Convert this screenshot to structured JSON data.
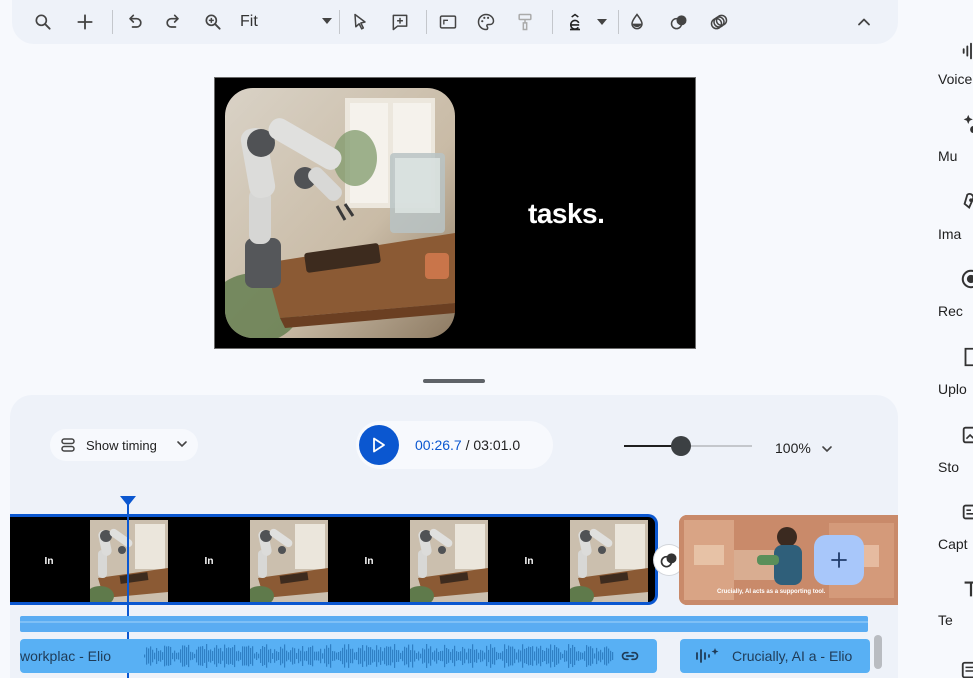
{
  "toolbar": {
    "zoom_fit_label": "Fit"
  },
  "preview": {
    "overlay_text": "tasks."
  },
  "timeline": {
    "show_timing_label": "Show timing",
    "current_time": "00:26.7",
    "separator": " / ",
    "total_time": "03:01.0",
    "zoom_percent": "100%",
    "zoom_level": 0.45,
    "clip_frames": [
      {
        "type": "text",
        "text": "In"
      },
      {
        "type": "photo"
      },
      {
        "type": "text",
        "text": "In"
      },
      {
        "type": "photo"
      },
      {
        "type": "text",
        "text": "In"
      },
      {
        "type": "photo"
      },
      {
        "type": "text",
        "text": "In"
      },
      {
        "type": "photo"
      }
    ],
    "second_clip_caption": "Crucially, AI acts as a supporting tool.",
    "audio_clips": [
      {
        "label": "workplac - Elio"
      },
      {
        "label": "Crucially, AI a - Elio"
      }
    ]
  },
  "rail": {
    "items": [
      {
        "label": "Voice",
        "icon": "voice-icon"
      },
      {
        "label": "Mu",
        "icon": "music-sparkle-icon"
      },
      {
        "label": "Ima",
        "icon": "image-icon"
      },
      {
        "label": "Rec",
        "icon": "record-icon"
      },
      {
        "label": "Uplo",
        "icon": "upload-icon"
      },
      {
        "label": "Sto",
        "icon": "stock-icon"
      },
      {
        "label": "Capt",
        "icon": "captions-icon"
      },
      {
        "label": "Te",
        "icon": "text-icon"
      }
    ]
  },
  "colors": {
    "accent": "#0b57d0",
    "audio": "#58b0f4",
    "fab": "#a8c7fa"
  }
}
